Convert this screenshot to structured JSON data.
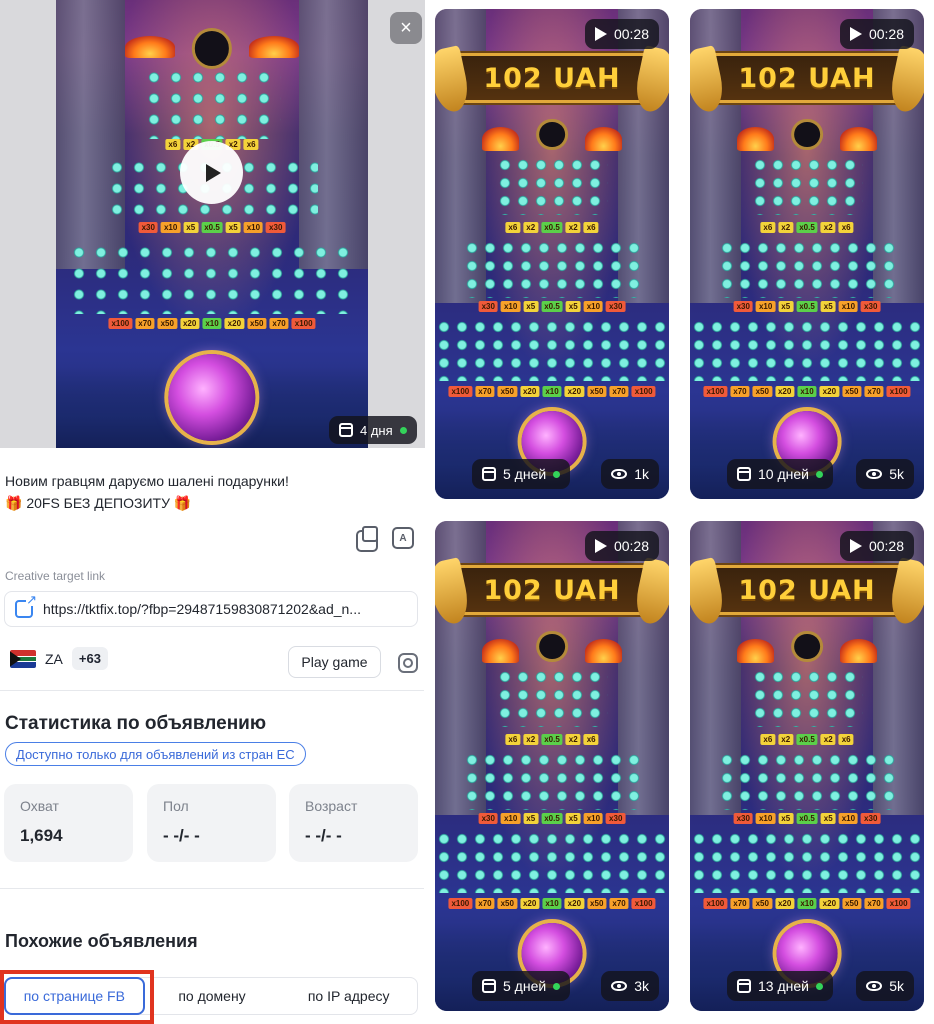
{
  "preview": {
    "close_label": "×",
    "age_label": "4 дня",
    "multipliers_top": [
      "x6",
      "x2",
      "x0.5",
      "x2",
      "x6"
    ],
    "multipliers_mid": [
      "x30",
      "x10",
      "x5",
      "x0.5",
      "x5",
      "x10",
      "x30"
    ],
    "multipliers_bottom": [
      "x100",
      "x70",
      "x50",
      "x20",
      "x10",
      "x20",
      "x50",
      "x70",
      "x100"
    ]
  },
  "ad": {
    "line1": "Новим гравцям даруємо шалені подарунки!",
    "line2": "🎁 20FS БЕЗ ДЕПОЗИТУ 🎁"
  },
  "link": {
    "label": "Creative target link",
    "url": "https://tktfix.top/?fbp=29487159830871202&ad_n..."
  },
  "geo": {
    "country": "ZA",
    "more": "+63",
    "play_button": "Play game"
  },
  "stats": {
    "title": "Статистика по объявлению",
    "eu_note": "Доступно только для объявлений из стран ЕС",
    "cards": [
      {
        "label": "Охват",
        "value": "1,694"
      },
      {
        "label": "Пол",
        "value": "- -/- -"
      },
      {
        "label": "Возраст",
        "value": "- -/- -"
      }
    ]
  },
  "similar": {
    "title": "Похожие объявления",
    "tabs": [
      "по странице FB",
      "по домену",
      "по IP адресу"
    ]
  },
  "grid": [
    {
      "duration": "00:28",
      "amount": "102 UAH",
      "age": "5 дней",
      "views": "1k"
    },
    {
      "duration": "00:28",
      "amount": "102 UAH",
      "age": "10 дней",
      "views": "5k"
    },
    {
      "duration": "00:28",
      "amount": "102 UAH",
      "age": "5 дней",
      "views": "3k"
    },
    {
      "duration": "00:28",
      "amount": "102 UAH",
      "age": "13 дней",
      "views": "5k"
    }
  ],
  "colors": {
    "accent": "#3a6ad9",
    "highlight": "#e0341f",
    "live_dot": "#33d35a",
    "banner_gold": "#ffcf3a"
  }
}
